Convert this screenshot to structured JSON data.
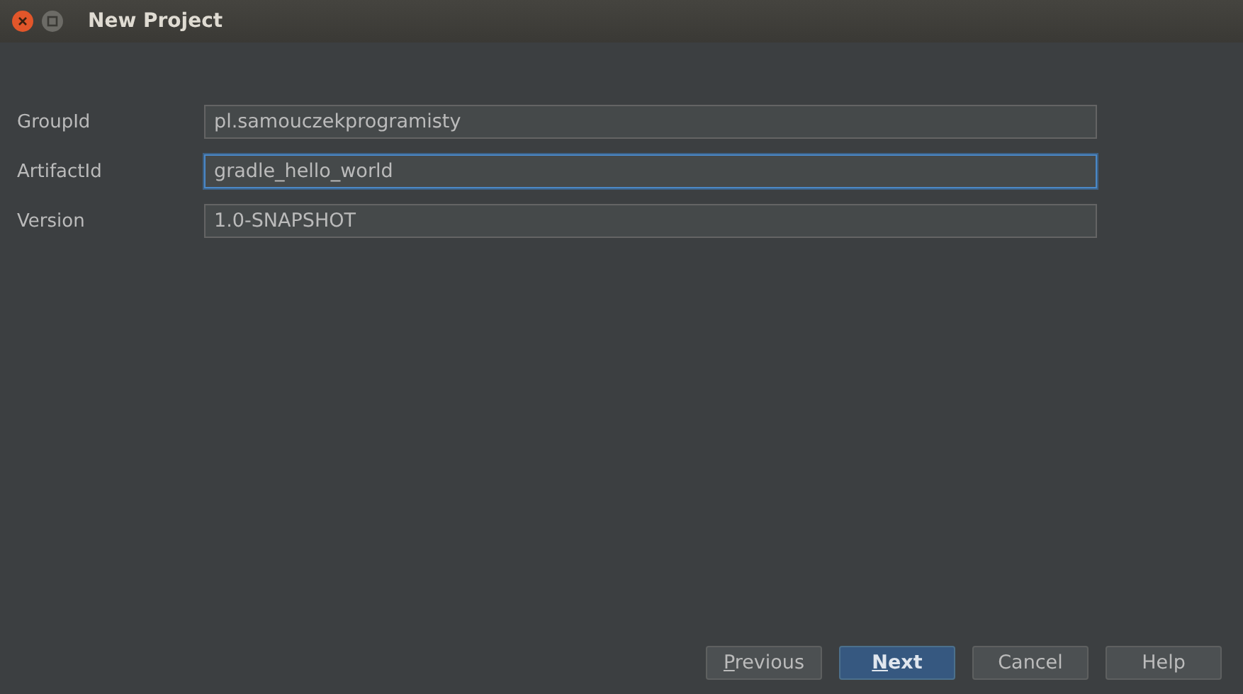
{
  "window": {
    "title": "New Project"
  },
  "fields": [
    {
      "label": "GroupId",
      "value": "pl.samouczekprogramisty",
      "focused": false
    },
    {
      "label": "ArtifactId",
      "value": "gradle_hello_world",
      "focused": true
    },
    {
      "label": "Version",
      "value": "1.0-SNAPSHOT",
      "focused": false
    }
  ],
  "buttons": [
    {
      "label": "Previous",
      "underline_first": true,
      "default": false
    },
    {
      "label": "Next",
      "underline_first": true,
      "default": true
    },
    {
      "label": "Cancel",
      "underline_first": false,
      "default": false
    },
    {
      "label": "Help",
      "underline_first": false,
      "default": false
    }
  ]
}
